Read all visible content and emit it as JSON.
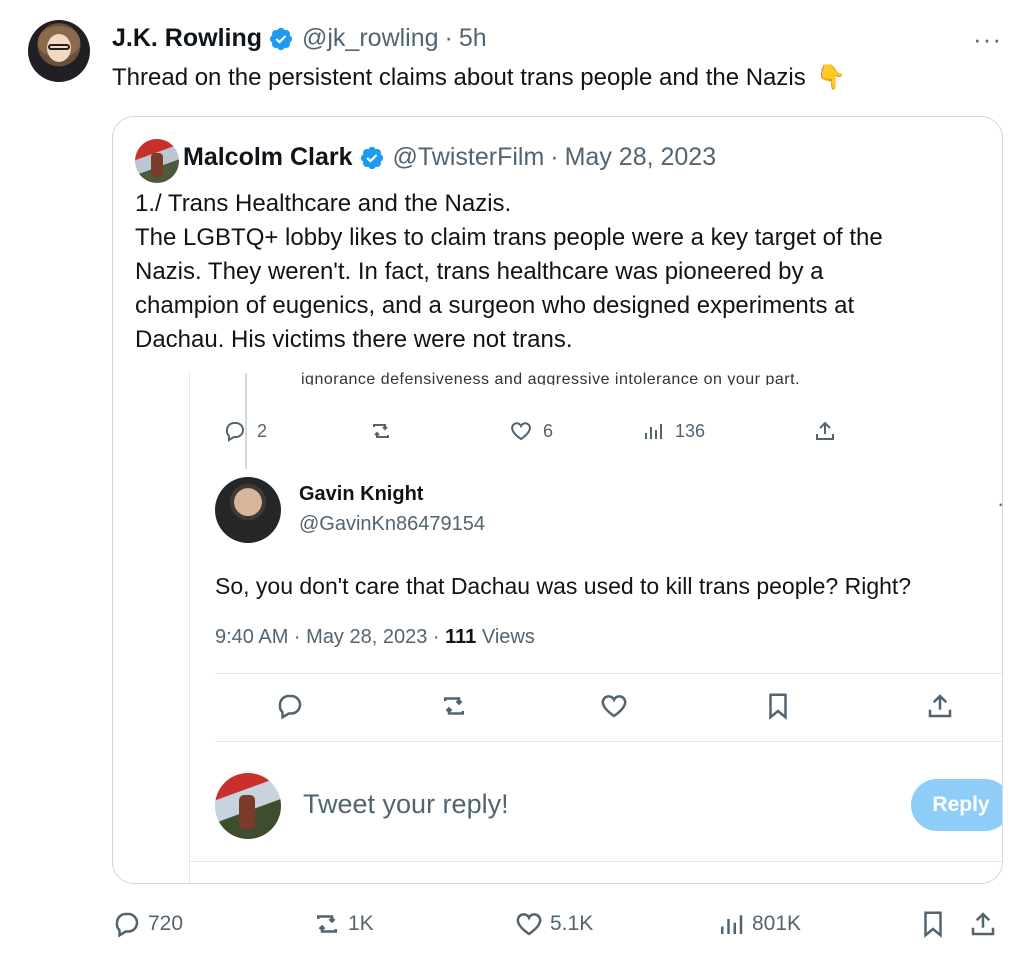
{
  "tweet": {
    "author_name": "J.K. Rowling",
    "author_handle": "@jk_rowling",
    "time": "5h",
    "more": "···",
    "text": "Thread on the persistent claims about trans people and the Nazis",
    "emoji": "👇"
  },
  "quoted": {
    "author_name": "Malcolm Clark",
    "author_handle": "@TwisterFilm",
    "date": "May 28, 2023",
    "lines": [
      "1./ Trans Healthcare and the Nazis.",
      "The LGBTQ+ lobby likes to claim trans people were a key target of the",
      "Nazis. They weren't. In fact, trans healthcare was pioneered by a",
      "champion of eugenics, and a surgeon who designed experiments at",
      "Dachau. His victims there were not trans."
    ]
  },
  "screenshot": {
    "cut_text": "ignorance defensiveness and aggressive intolerance on your part.",
    "mini_actions": {
      "replies": "2",
      "likes": "6",
      "views": "136"
    },
    "reply_tweet": {
      "author_name": "Gavin Knight",
      "author_handle": "@GavinKn86479154",
      "text": "So, you don't care that Dachau was used to kill trans people? Right?",
      "time": "9:40 AM · May 28, 2023 · ",
      "views_count": "111",
      "views_label": " Views"
    },
    "reply_placeholder": "Tweet your reply!",
    "reply_button": "Reply"
  },
  "actions": {
    "replies": "720",
    "retweets": "1K",
    "likes": "5.1K",
    "views": "801K"
  },
  "colors": {
    "verified": "#1d9bf0",
    "secondary_text": "#536471",
    "reply_button": "#8ecdf8"
  },
  "icons": [
    "verified-badge-icon",
    "more-icon",
    "reply-icon",
    "retweet-icon",
    "like-icon",
    "views-icon",
    "bookmark-icon",
    "share-icon"
  ]
}
